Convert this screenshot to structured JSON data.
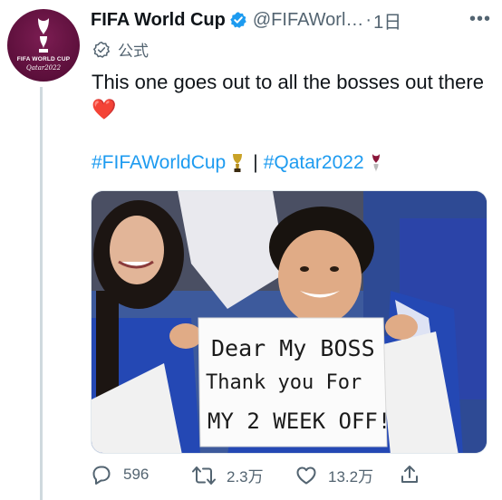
{
  "account": {
    "name": "FIFA World Cup",
    "handle": "@FIFAWorl…",
    "separator": "·",
    "time": "1日",
    "official_label": "公式",
    "avatar_text_line1": "FIFA WORLD CUP",
    "avatar_text_line2": "Qatar2022"
  },
  "tweet": {
    "text": "This one goes out to all the bosses out there",
    "emoji": "❤️",
    "hashtags": [
      "#FIFAWorldCup",
      "#Qatar2022"
    ],
    "hashtag_separator": "|"
  },
  "photo": {
    "sign_lines": [
      "Dear My BOSS",
      "Thank you For",
      "MY 2 WEEK OFF!"
    ]
  },
  "actions": {
    "replies": "596",
    "retweets": "2.3万",
    "likes": "13.2万"
  },
  "colors": {
    "accent": "#1d9bf0",
    "secondary_text": "#536471",
    "avatar_bg": "#5c0f3b",
    "heart": "#e8263d"
  },
  "icons": [
    "verified-badge-icon",
    "official-badge-icon",
    "more-icon",
    "trophy-icon",
    "emblem-icon",
    "reply-icon",
    "retweet-icon",
    "like-icon",
    "share-icon"
  ]
}
